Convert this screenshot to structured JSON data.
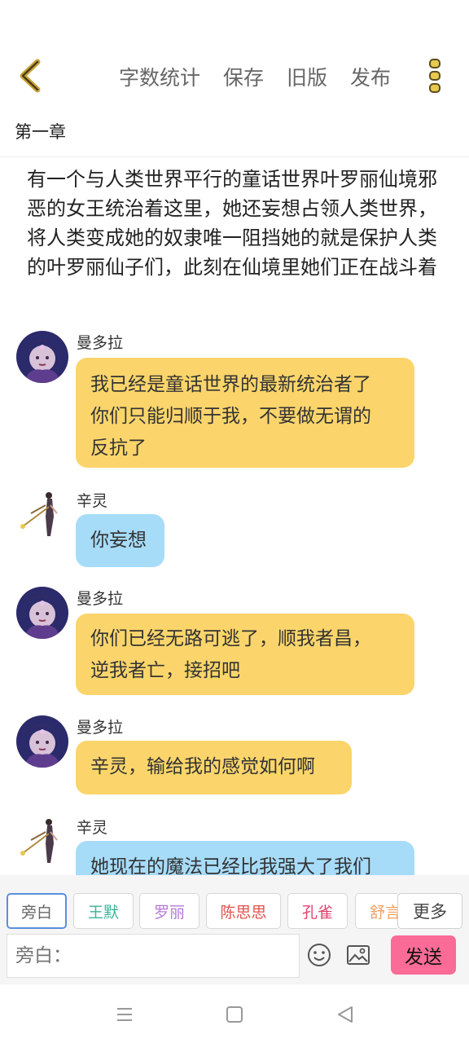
{
  "header": {
    "actions": [
      "字数统计",
      "保存",
      "旧版",
      "发布"
    ]
  },
  "chapter": {
    "title": "第一章"
  },
  "narration": "有一个与人类世界平行的童话世界叶罗丽仙境邪恶的女王统治着这里，她还妄想占领人类世界，将人类变成她的奴隶唯一阻挡她的就是保护人类的叶罗丽仙子们，此刻在仙境里她们正在战斗着",
  "messages": [
    {
      "speaker": "曼多拉",
      "lines": [
        "我已经是童话世界的最新统治者了",
        "你们只能归顺于我，不要做无谓的",
        "反抗了"
      ],
      "color": "#fbd56b"
    },
    {
      "speaker": "辛灵",
      "lines": [
        "你妄想"
      ],
      "color": "#a7dcf9"
    },
    {
      "speaker": "曼多拉",
      "lines": [
        "你们已经无路可逃了，顺我者昌，",
        "逆我者亡，接招吧"
      ],
      "color": "#fbd56b"
    },
    {
      "speaker": "曼多拉",
      "lines": [
        "辛灵，输给我的感觉如何啊"
      ],
      "color": "#fbd56b"
    },
    {
      "speaker": "辛灵",
      "lines": [
        "她现在的魔法已经比我强大了我们"
      ],
      "color": "#a7dcf9"
    }
  ],
  "characters": [
    {
      "label": "旁白",
      "color": "#666666"
    },
    {
      "label": "王默",
      "color": "#3bb39a"
    },
    {
      "label": "罗丽",
      "color": "#b67ad6"
    },
    {
      "label": "陈思思",
      "color": "#e0534e"
    },
    {
      "label": "孔雀",
      "color": "#e0436e"
    },
    {
      "label": "舒言",
      "color": "#f0a060"
    }
  ],
  "more_label": "更多",
  "input": {
    "placeholder": "旁白："
  },
  "send_label": "发送",
  "icons": {
    "back": "chevron-left-icon",
    "more": "vertical-dots-icon",
    "emoji": "smiley-icon",
    "image": "image-icon",
    "nav_menu": "menu-icon",
    "nav_home": "square-icon",
    "nav_back": "triangle-back-icon"
  },
  "colors": {
    "accent": "#d9b83a",
    "send": "#fa6b97",
    "active_chip": "#5b8fdc"
  }
}
